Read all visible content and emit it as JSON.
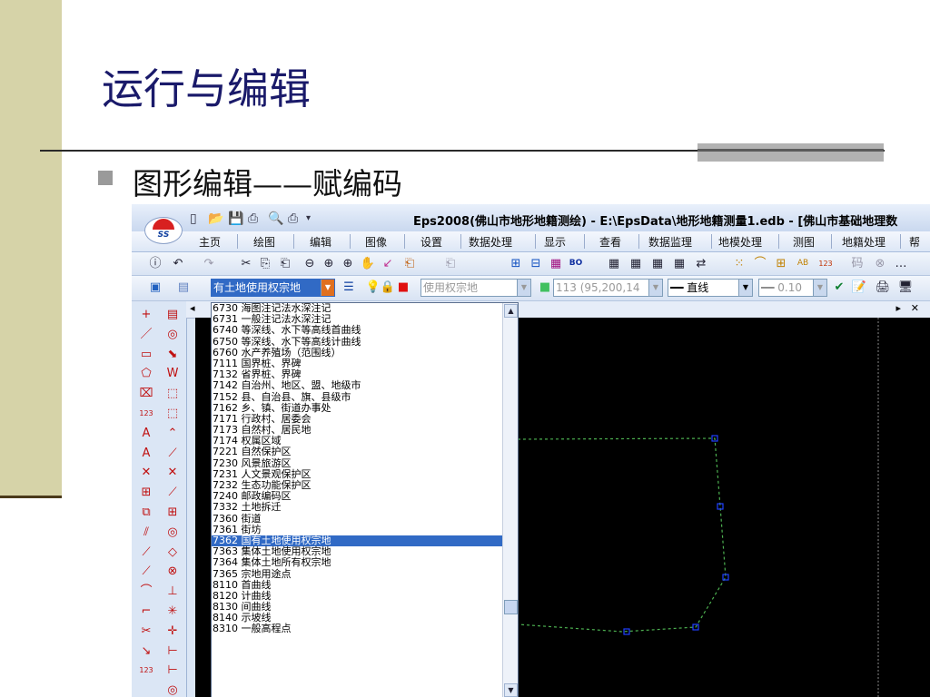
{
  "slide": {
    "title": "运行与编辑",
    "bullet": "图形编辑——赋编码"
  },
  "app": {
    "logo_text": "SS",
    "title": "Eps2008(佛山市地形地籍测绘) - E:\\EpsData\\地形地籍测量1.edb - [佛山市基础地理数",
    "menu": [
      "主页",
      "绘图",
      "编辑",
      "图像",
      "设置",
      "数据处理",
      "显示",
      "查看",
      "数据监理",
      "地模处理",
      "测图",
      "地籍处理",
      "帮"
    ],
    "layer_combo": "有土地使用权宗地",
    "layer_name": "使用权宗地",
    "color_combo": "113 (95,200,14",
    "linetype_combo": "直线",
    "width_combo": "0.10",
    "tab_prev_icon": "◂",
    "tab_next_icon": "▸",
    "tab_close_icon": "✕"
  },
  "dropdown": {
    "selected_index": 27,
    "items": [
      "6730 海图注记法水深注记",
      "6731 一般注记法水深注记",
      "6740 等深线、水下等高线首曲线",
      "6750 等深线、水下等高线计曲线",
      "6760 水产养殖场（范围线）",
      "7111 国界桩、界碑",
      "7132 省界桩、界碑",
      "7142 自治州、地区、盟、地级市",
      "7152 县、自治县、旗、县级市",
      "7162 乡、镇、街道办事处",
      "7171 行政村、居委会",
      "7173 自然村、居民地",
      "7174 权属区域",
      "7221 自然保护区",
      "7230 风景旅游区",
      "7231 人文景观保护区",
      "7232 生态功能保护区",
      "7240 邮政编码区",
      "7332 土地拆迁",
      "7360 街道",
      "7361 街坊",
      "7362 国有土地使用权宗地",
      "7363 集体土地使用权宗地",
      "7364 集体土地所有权宗地",
      "7365 宗地用途点",
      "8110 首曲线",
      "8120 计曲线",
      "8130 间曲线",
      "8140 示坡线",
      "8310 一般高程点"
    ]
  },
  "colors": {
    "selection": "#316ac5",
    "canvas": "#000000",
    "boundary_line": "#4caf50",
    "vertex": "#2040ff"
  },
  "left_tools": {
    "col1": [
      "+",
      "／",
      "▭",
      "⬠",
      "⌧",
      "123",
      "A",
      "A",
      "✕",
      "⊞",
      "⧉",
      "⫽",
      "⟋",
      "⟋",
      "⌒",
      "⌐",
      "✂",
      "↘",
      "123"
    ],
    "col2": [
      "▤",
      "◎",
      "⬊",
      "W",
      "⬚",
      "⬚",
      "⌃",
      "⟋",
      "✕",
      "⟋",
      "⊞",
      "◎",
      "◇",
      "⊗",
      "⊥",
      "✳",
      "✛",
      "⊢",
      "⊢",
      "◎"
    ]
  },
  "toolbar_icons": {
    "quick": [
      "▯",
      "📂",
      "💾",
      "⎙",
      "🔍",
      "⎙",
      "▾"
    ],
    "row1": [
      "ⓘ",
      "↶",
      "↷",
      "✂",
      "⎘",
      "⎗",
      "⊖",
      "⊕",
      "⊕",
      "✋",
      "↙",
      "⎗",
      "⎗",
      "⊞",
      "⊟",
      "▦",
      "BO",
      "▦",
      "▦",
      "▦",
      "▦",
      "⇄",
      "⁙",
      "⌒",
      "⊞",
      "AB",
      "123",
      "码",
      "⊗",
      "…"
    ],
    "row2": [
      "▣",
      "▤",
      "☰",
      "💡",
      "🔒",
      "■",
      "■",
      "✔",
      "📝",
      "🖨",
      "🖥"
    ]
  }
}
